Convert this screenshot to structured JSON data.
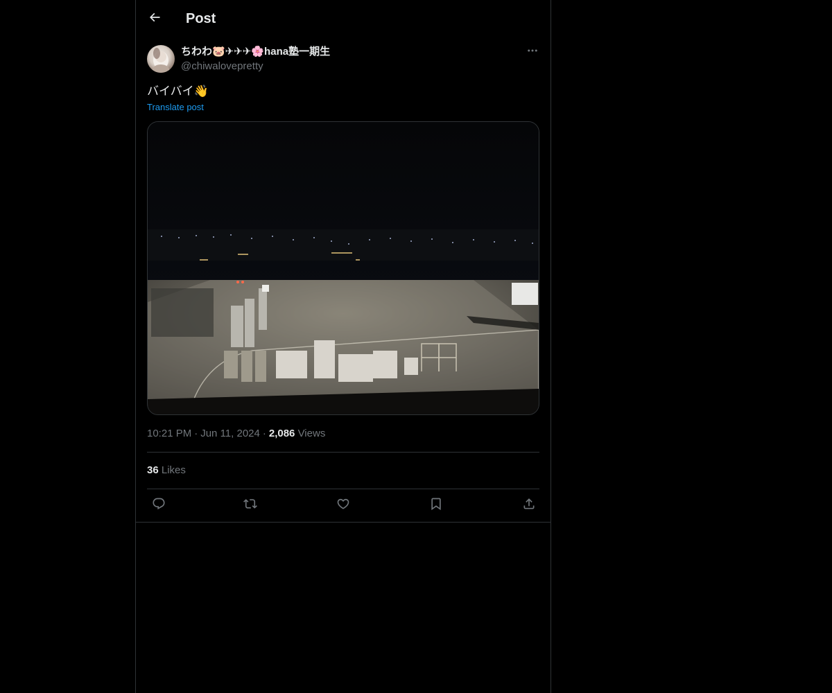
{
  "header": {
    "title": "Post",
    "back_icon": "arrow-left-icon"
  },
  "author": {
    "display_name": "ちわわ🐷✈✈✈🌸hana塾一期生",
    "handle": "@chiwalovepretty",
    "more_icon": "more-horizontal-icon"
  },
  "post": {
    "text": "バイバイ👋",
    "translate_label": "Translate post",
    "media_description_icon": "night-airport-apron-photo"
  },
  "meta": {
    "time": "10:21 PM",
    "date": "Jun 11, 2024",
    "views_count": "2,086",
    "views_label": "Views",
    "separator": "·"
  },
  "stats": {
    "likes_count": "36",
    "likes_label": "Likes"
  },
  "actions": [
    {
      "name": "reply",
      "icon": "reply-icon"
    },
    {
      "name": "repost",
      "icon": "repost-icon"
    },
    {
      "name": "like",
      "icon": "heart-icon"
    },
    {
      "name": "bookmark",
      "icon": "bookmark-icon"
    },
    {
      "name": "share",
      "icon": "share-icon"
    }
  ],
  "colors": {
    "background": "#000000",
    "text_primary": "#e7e9ea",
    "text_secondary": "#71767b",
    "accent": "#1d9bf0",
    "border": "#2f3336"
  }
}
